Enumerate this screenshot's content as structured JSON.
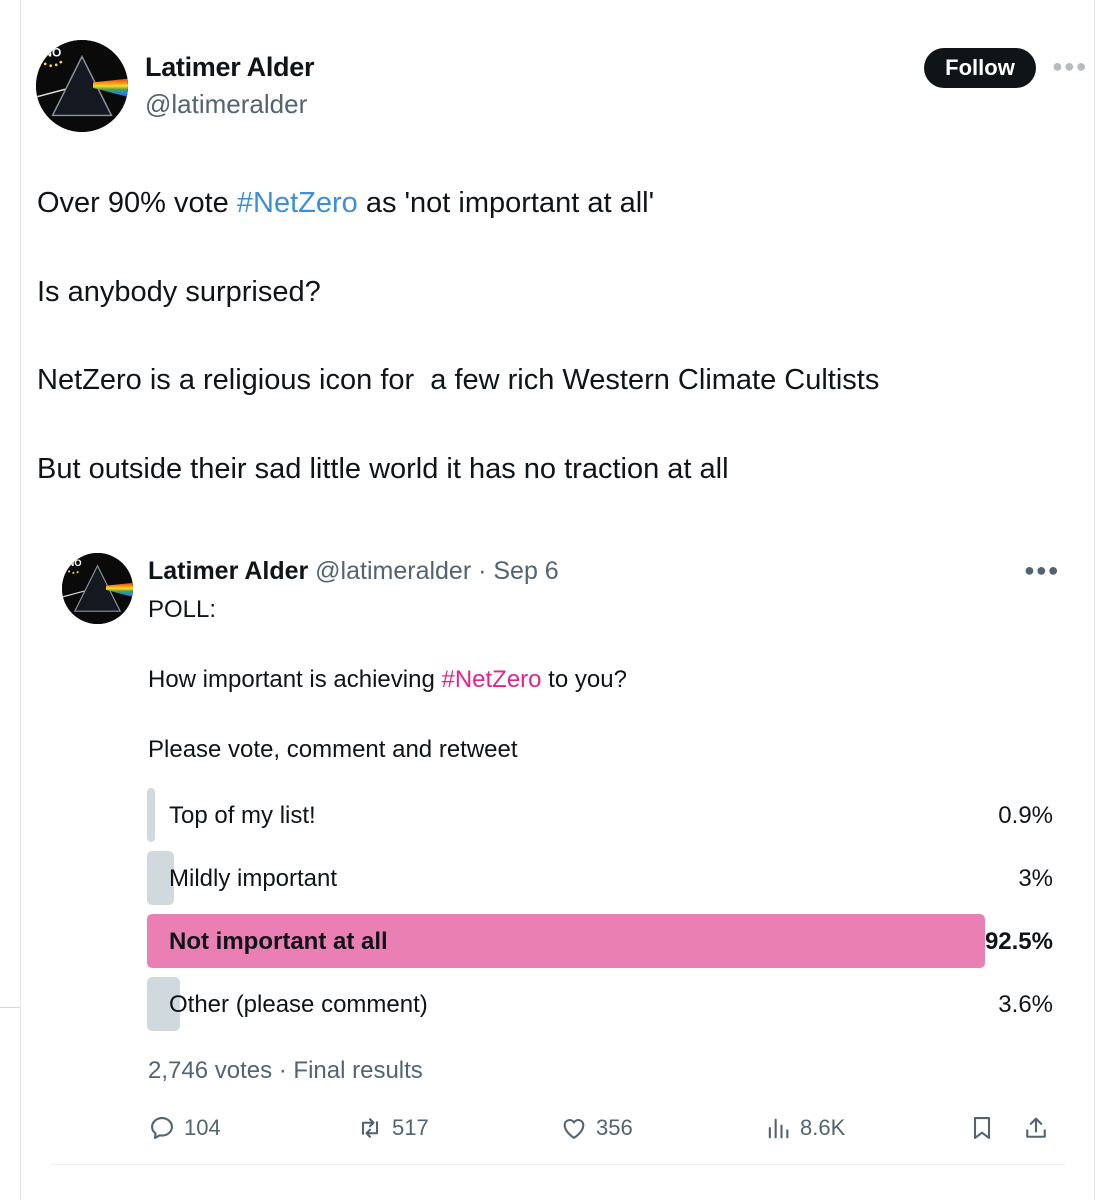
{
  "tweet": {
    "author": {
      "name": "Latimer Alder",
      "handle": "@latimeralder",
      "avatar_icon": "prism-avatar-icon"
    },
    "follow_label": "Follow",
    "more_icon": "more-horizontal-icon",
    "text_lines": {
      "line1_before": "Over 90% vote ",
      "line1_hashtag": "#NetZero",
      "line1_after": " as 'not important at all'",
      "line2": "Is anybody surprised?",
      "line3": "NetZero is a religious icon for  a few rich Western Climate Cultists",
      "line4": "But outside their sad little world it has no traction at all"
    },
    "colors": {
      "hashtag": "#3c8fd8",
      "follow_bg": "#0f1419"
    }
  },
  "quoted": {
    "author_name": "Latimer Alder",
    "meta": " @latimeralder · Sep 6",
    "line1": "POLL:",
    "line2_before": "How important is achieving ",
    "line2_hashtag": "#NetZero",
    "line2_after": " to you?",
    "line3": "Please vote, comment and retweet",
    "colors": {
      "hashtag": "#e0268a",
      "winner_bar": "#ea7fb3",
      "bar": "#cfd9de"
    }
  },
  "poll": {
    "options": [
      {
        "label": "Top of my list!",
        "percent_text": "0.9%",
        "percent": 0.9,
        "winner": false
      },
      {
        "label": "Mildly important",
        "percent_text": "3%",
        "percent": 3,
        "winner": false
      },
      {
        "label": "Not important at all",
        "percent_text": "92.5%",
        "percent": 92.5,
        "winner": true
      },
      {
        "label": "Other (please comment)",
        "percent_text": "3.6%",
        "percent": 3.6,
        "winner": false
      }
    ],
    "footer": "2,746 votes · Final results"
  },
  "actions": {
    "replies": "104",
    "reposts": "517",
    "likes": "356",
    "views": "8.6K"
  }
}
